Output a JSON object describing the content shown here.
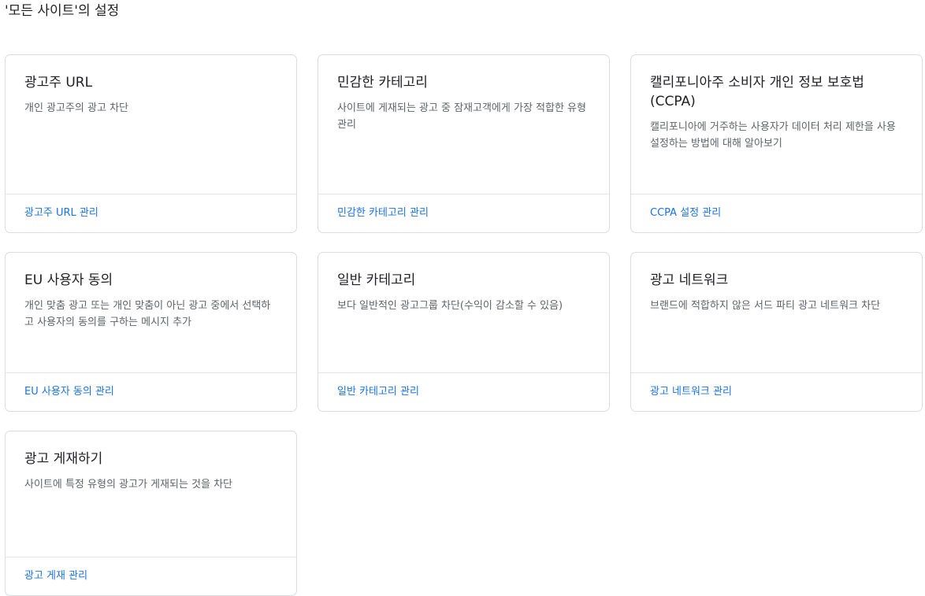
{
  "page": {
    "title": "'모든 사이트'의 설정"
  },
  "cards": [
    {
      "title": "광고주 URL",
      "description": "개인 광고주의 광고 차단",
      "link": "광고주 URL 관리"
    },
    {
      "title": "민감한 카테고리",
      "description": "사이트에 게재되는 광고 중 잠재고객에게 가장 적합한 유형 관리",
      "link": "민감한 카테고리 관리"
    },
    {
      "title": "캘리포니아주 소비자 개인 정보 보호법 (CCPA)",
      "description": "캘리포니아에 거주하는 사용자가 데이터 처리 제한을 사용 설정하는 방법에 대해 알아보기",
      "link": "CCPA 설정 관리"
    },
    {
      "title": "EU 사용자 동의",
      "description": "개인 맞춤 광고 또는 개인 맞춤이 아닌 광고 중에서 선택하고 사용자의 동의를 구하는 메시지 추가",
      "link": "EU 사용자 동의 관리"
    },
    {
      "title": "일반 카테고리",
      "description": "보다 일반적인 광고그룹 차단(수익이 감소할 수 있음)",
      "link": "일반 카테고리 관리"
    },
    {
      "title": "광고 네트워크",
      "description": "브랜드에 적합하지 않은 서드 파티 광고 네트워크 차단",
      "link": "광고 네트워크 관리"
    },
    {
      "title": "광고 게재하기",
      "description": "사이트에 특정 유형의 광고가 게재되는 것을 차단",
      "link": "광고 게재 관리"
    }
  ],
  "colors": {
    "link": "#1a73e8",
    "border": "#dadce0",
    "text": "#202124",
    "muted": "#5f6368"
  }
}
